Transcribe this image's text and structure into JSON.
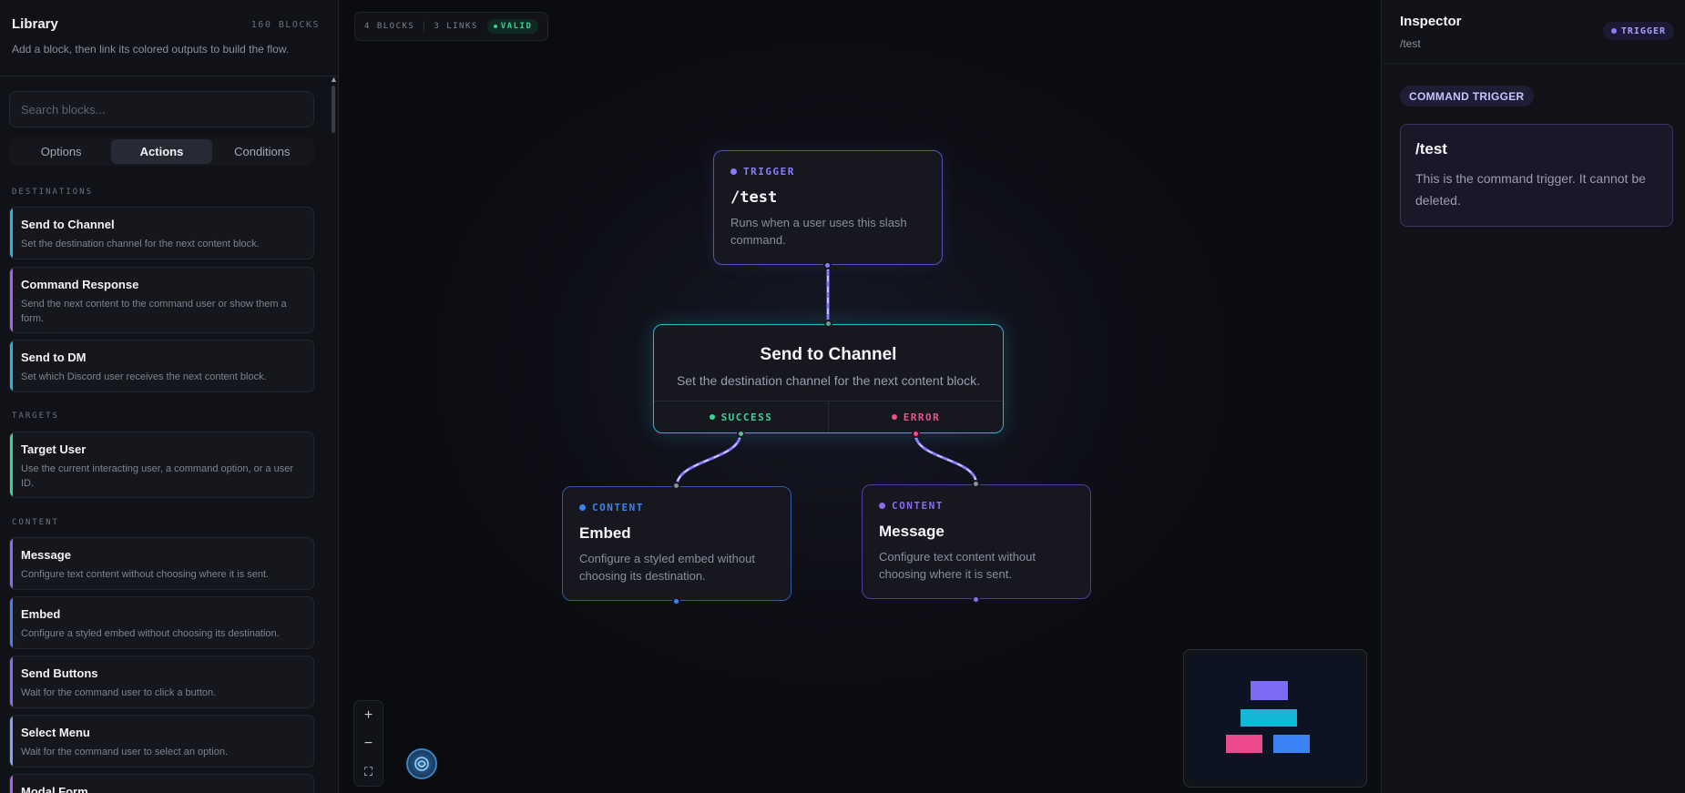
{
  "library": {
    "title": "Library",
    "count": "160 BLOCKS",
    "subtitle": "Add a block, then link its colored outputs to build the flow.",
    "search_placeholder": "Search blocks...",
    "tabs": [
      "Options",
      "Actions",
      "Conditions"
    ],
    "active_tab": "Actions",
    "sections": {
      "destinations": "DESTINATIONS",
      "targets": "TARGETS",
      "content": "CONTENT"
    },
    "blocks": [
      {
        "title": "Send to Channel",
        "desc": "Set the destination channel for the next content block.",
        "accent": "#22b8d8"
      },
      {
        "title": "Command Response",
        "desc": "Send the next content to the command user or show them a form.",
        "accent": "#b45ce8"
      },
      {
        "title": "Send to DM",
        "desc": "Set which Discord user receives the next content block.",
        "accent": "#22b8d8"
      },
      {
        "title": "Target User",
        "desc": "Use the current interacting user, a command option, or a user ID.",
        "accent": "#34d399"
      },
      {
        "title": "Message",
        "desc": "Configure text content without choosing where it is sent.",
        "accent": "#8b6cf0"
      },
      {
        "title": "Embed",
        "desc": "Configure a styled embed without choosing its destination.",
        "accent": "#3b82f6"
      },
      {
        "title": "Send Buttons",
        "desc": "Wait for the command user to click a button.",
        "accent": "#8b6cf0"
      },
      {
        "title": "Select Menu",
        "desc": "Wait for the command user to select an option.",
        "accent": "#8aa0f0"
      },
      {
        "title": "Modal Form",
        "desc": "",
        "accent": "#b45ce8"
      }
    ]
  },
  "canvas": {
    "stats": {
      "blocks": "4 BLOCKS",
      "links": "3 LINKS",
      "status": "VALID"
    },
    "trigger_node": {
      "tag": "TRIGGER",
      "title": "/test",
      "desc": "Runs when a user uses this slash command."
    },
    "channel_node": {
      "title": "Send to Channel",
      "desc": "Set the destination channel for the next content block.",
      "success": "SUCCESS",
      "error": "ERROR"
    },
    "embed_node": {
      "tag": "CONTENT",
      "title": "Embed",
      "desc": "Configure a styled embed without choosing its destination."
    },
    "message_node": {
      "tag": "CONTENT",
      "title": "Message",
      "desc": "Configure text content without choosing where it is sent."
    },
    "zoom": {
      "in": "+",
      "out": "−",
      "fit": "⛶"
    }
  },
  "inspector": {
    "title": "Inspector",
    "path": "/test",
    "badge": "TRIGGER",
    "chip": "COMMAND TRIGGER",
    "card_title": "/test",
    "card_desc": "This is the command trigger. It cannot be deleted."
  },
  "colors": {
    "trigger": "#8b7bff",
    "channel": "#22b8d8",
    "embed": "#3b82f6",
    "message": "#8b6cf0",
    "success": "#34d399",
    "error": "#f0508a"
  }
}
